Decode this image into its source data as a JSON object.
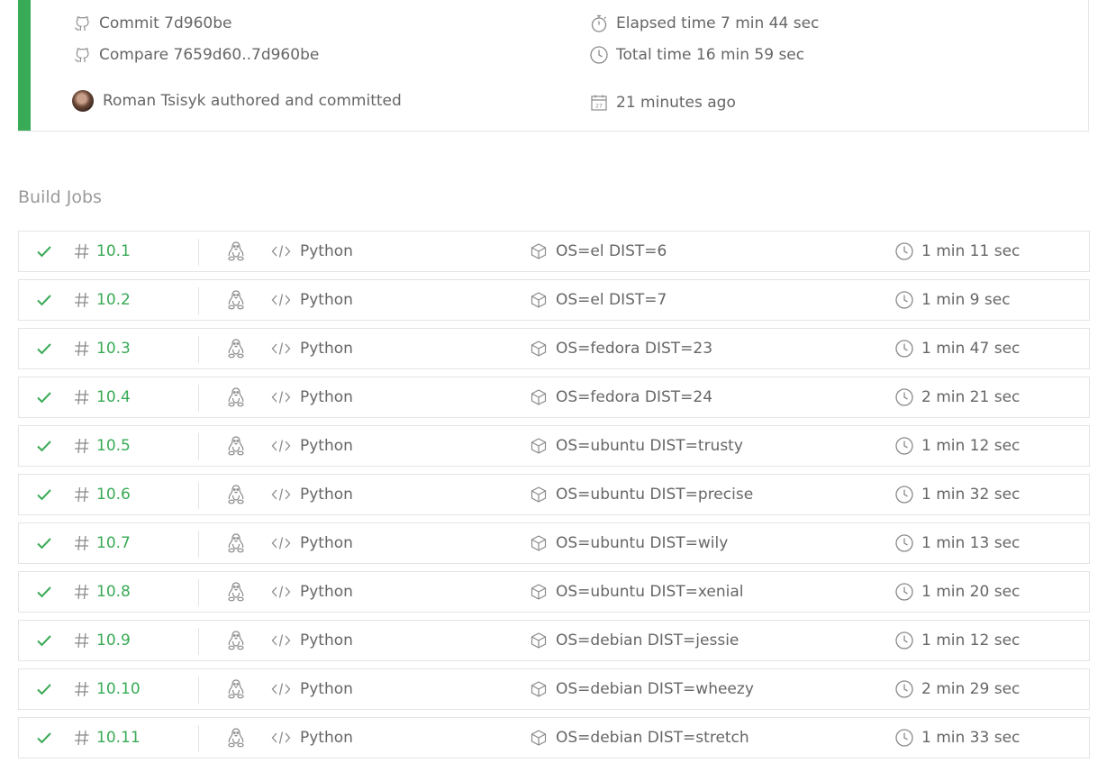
{
  "build": {
    "commit_label": "Commit 7d960be",
    "compare_label": "Compare 7659d60..7d960be",
    "author_text": "Roman Tsisyk authored and committed",
    "elapsed_label": "Elapsed time 7 min 44 sec",
    "total_label": "Total time 16 min 59 sec",
    "ago_label": "21 minutes ago",
    "status_color": "#39aa56"
  },
  "section": {
    "title": "Build Jobs"
  },
  "jobs": [
    {
      "number": "10.1",
      "language": "Python",
      "env": "OS=el DIST=6",
      "duration": "1 min 11 sec"
    },
    {
      "number": "10.2",
      "language": "Python",
      "env": "OS=el DIST=7",
      "duration": "1 min 9 sec"
    },
    {
      "number": "10.3",
      "language": "Python",
      "env": "OS=fedora DIST=23",
      "duration": "1 min 47 sec"
    },
    {
      "number": "10.4",
      "language": "Python",
      "env": "OS=fedora DIST=24",
      "duration": "2 min 21 sec"
    },
    {
      "number": "10.5",
      "language": "Python",
      "env": "OS=ubuntu DIST=trusty",
      "duration": "1 min 12 sec"
    },
    {
      "number": "10.6",
      "language": "Python",
      "env": "OS=ubuntu DIST=precise",
      "duration": "1 min 32 sec"
    },
    {
      "number": "10.7",
      "language": "Python",
      "env": "OS=ubuntu DIST=wily",
      "duration": "1 min 13 sec"
    },
    {
      "number": "10.8",
      "language": "Python",
      "env": "OS=ubuntu DIST=xenial",
      "duration": "1 min 20 sec"
    },
    {
      "number": "10.9",
      "language": "Python",
      "env": "OS=debian DIST=jessie",
      "duration": "1 min 12 sec"
    },
    {
      "number": "10.10",
      "language": "Python",
      "env": "OS=debian DIST=wheezy",
      "duration": "2 min 29 sec"
    },
    {
      "number": "10.11",
      "language": "Python",
      "env": "OS=debian DIST=stretch",
      "duration": "1 min 33 sec"
    }
  ],
  "icons": {
    "status": "check-icon",
    "number": "hash-icon",
    "os": "linux-penguin-icon",
    "language": "code-icon",
    "env": "box-icon",
    "duration": "clock-icon"
  }
}
